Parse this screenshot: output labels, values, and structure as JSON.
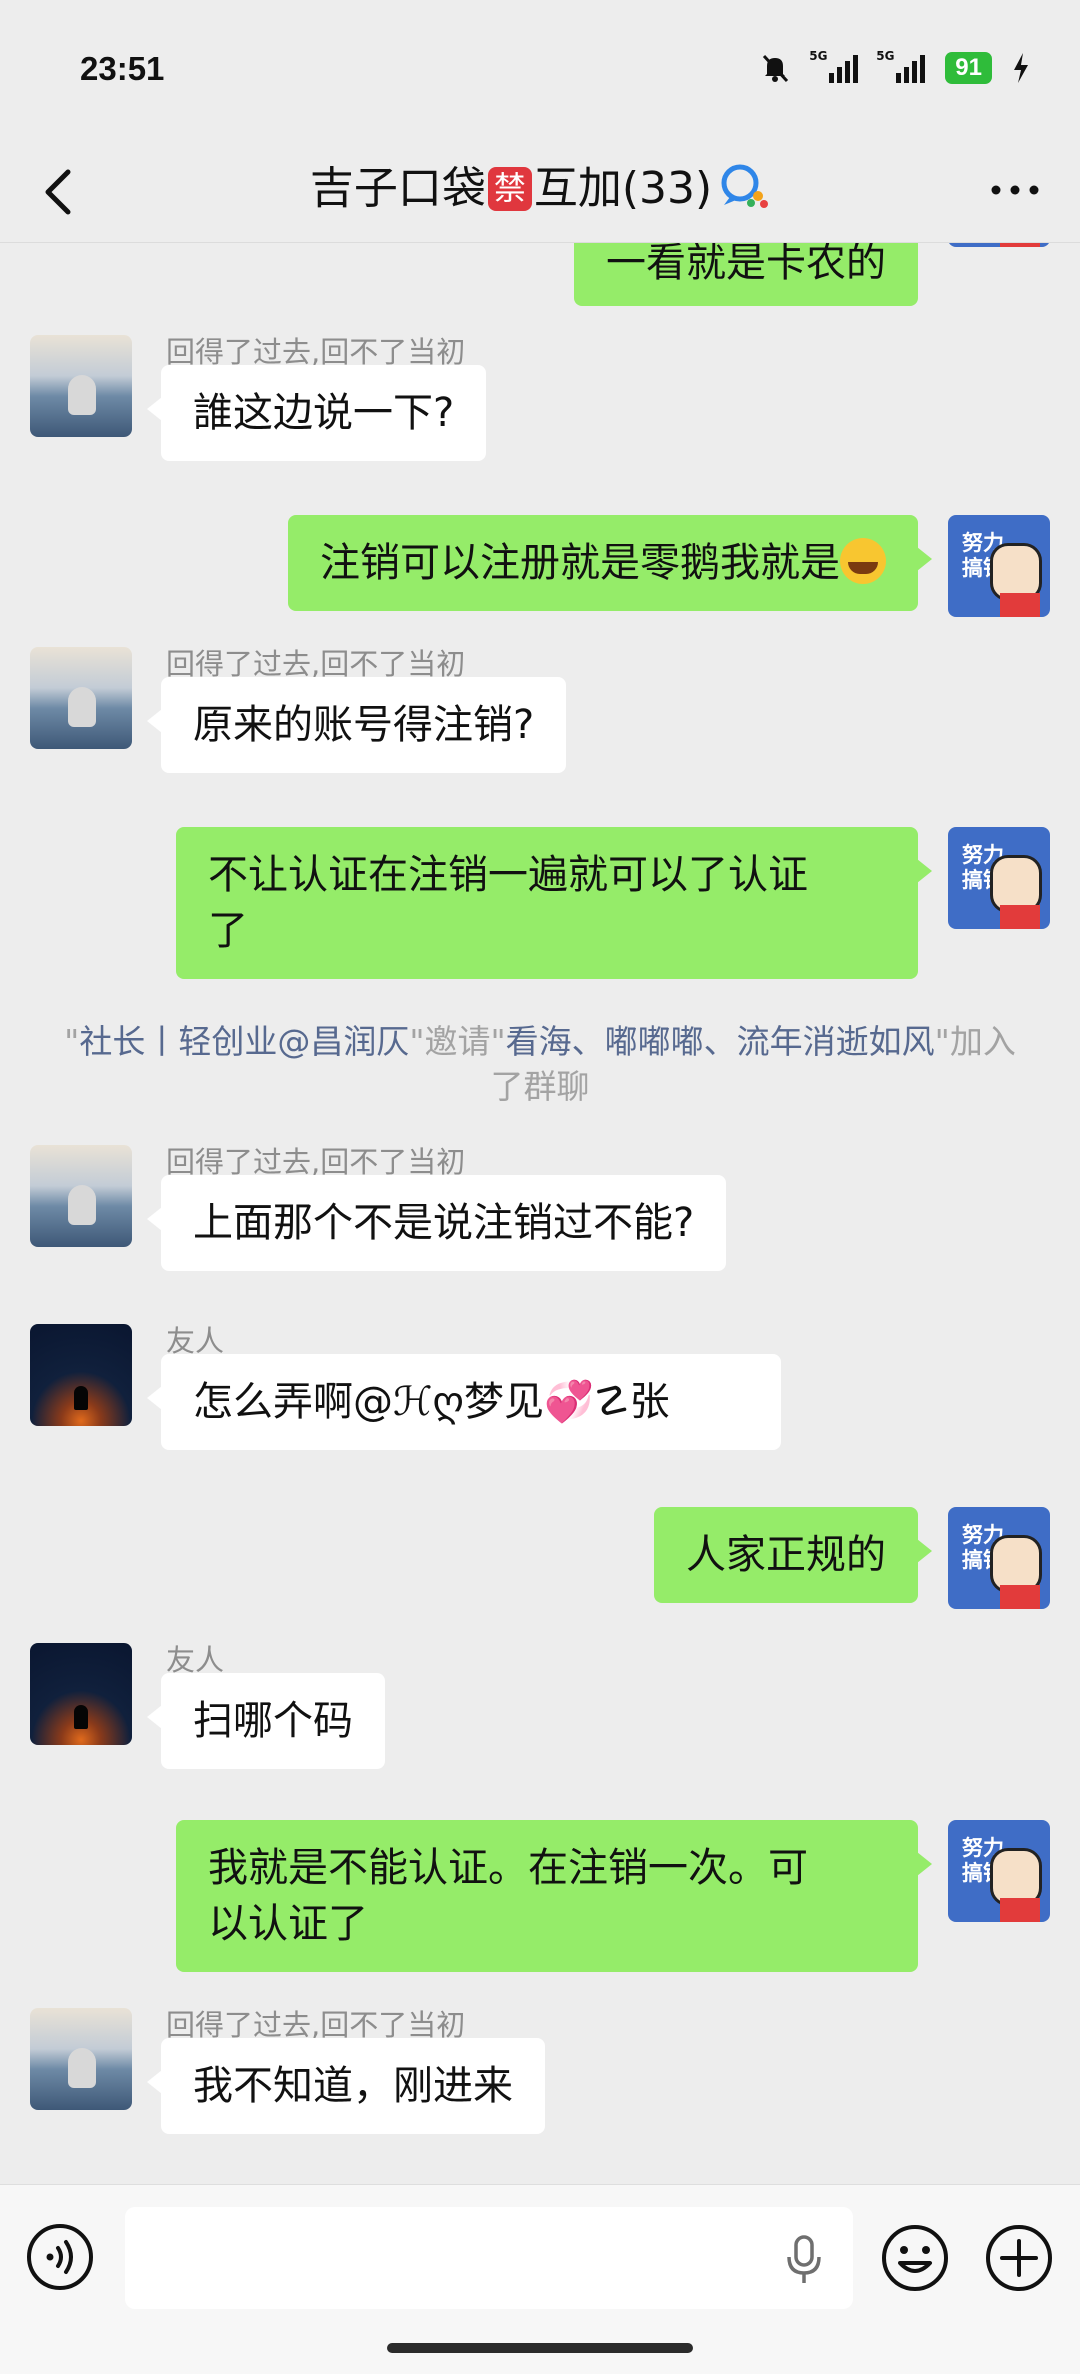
{
  "status_bar": {
    "time": "23:51",
    "net1": "5G",
    "net2": "5G",
    "battery": "91"
  },
  "header": {
    "title_part1": "吉子口袋",
    "title_ban": "禁",
    "title_part2": "互加(33)"
  },
  "messages": [
    {
      "dir": "out",
      "text": "一看就是卡农的"
    },
    {
      "dir": "in",
      "sender": "回得了过去,回不了当初",
      "text": "誰这边说一下?"
    },
    {
      "dir": "out",
      "text": "注销可以注册就是零鹅我就是"
    },
    {
      "dir": "in",
      "sender": "回得了过去,回不了当初",
      "text": "原来的账号得注销?"
    },
    {
      "dir": "out",
      "text": "不让认证在注销一遍就可以了认证\n了"
    },
    {
      "dir": "in",
      "sender": "回得了过去,回不了当初",
      "text": "上面那个不是说注销过不能?"
    },
    {
      "dir": "in",
      "sender": "友人",
      "text": "怎么弄啊@ℋღ梦见💞☡张"
    },
    {
      "dir": "out",
      "text": "人家正规的"
    },
    {
      "dir": "in",
      "sender": "友人",
      "text": "扫哪个码"
    },
    {
      "dir": "out",
      "text": "我就是不能认证。在注销一次。可\n以认证了"
    },
    {
      "dir": "in",
      "sender": "回得了过去,回不了当初",
      "text": "我不知道，刚进来"
    }
  ],
  "system_message": {
    "q1": "\"",
    "inviter": "社长丨轻创业@昌润仄",
    "mid": "\"邀请\"",
    "invitees": "看海、嘟嘟嘟、流年消逝如风",
    "end": "\"加入了群聊"
  },
  "avatar_me": {
    "text": "努力搞钱"
  },
  "colors": {
    "out_bubble": "#95ec69",
    "in_bubble": "#ffffff",
    "background": "#ededed",
    "ban_badge": "#e0373e",
    "battery": "#2fbc3a"
  }
}
